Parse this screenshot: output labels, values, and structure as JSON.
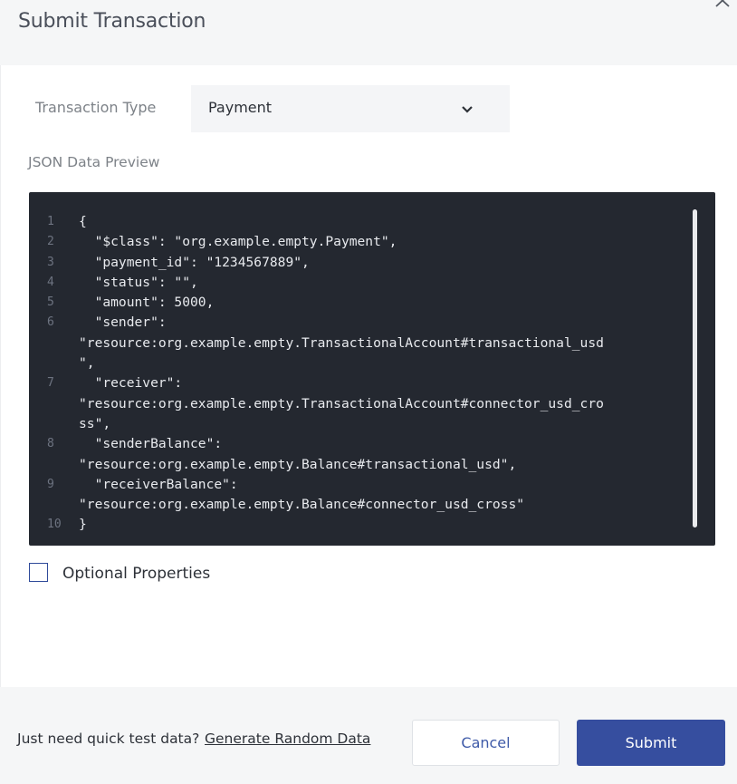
{
  "dialog": {
    "title": "Submit Transaction",
    "close_icon": "close-icon"
  },
  "form": {
    "type_label": "Transaction Type",
    "type_value": "Payment",
    "preview_label": "JSON Data Preview"
  },
  "editor": {
    "lines": [
      {
        "n": "1",
        "text": "{"
      },
      {
        "n": "2",
        "text": "  \"$class\": \"org.example.empty.Payment\","
      },
      {
        "n": "3",
        "text": "  \"payment_id\": \"1234567889\","
      },
      {
        "n": "4",
        "text": "  \"status\": \"\","
      },
      {
        "n": "5",
        "text": "  \"amount\": 5000,"
      },
      {
        "n": "6",
        "text": "  \"sender\":"
      },
      {
        "n": "",
        "text": "\"resource:org.example.empty.TransactionalAccount#transactional_usd"
      },
      {
        "n": "",
        "text": "\","
      },
      {
        "n": "7",
        "text": "  \"receiver\":"
      },
      {
        "n": "",
        "text": "\"resource:org.example.empty.TransactionalAccount#connector_usd_cro"
      },
      {
        "n": "",
        "text": "ss\","
      },
      {
        "n": "8",
        "text": "  \"senderBalance\":"
      },
      {
        "n": "",
        "text": "\"resource:org.example.empty.Balance#transactional_usd\","
      },
      {
        "n": "9",
        "text": "  \"receiverBalance\":"
      },
      {
        "n": "",
        "text": "\"resource:org.example.empty.Balance#connector_usd_cross\""
      },
      {
        "n": "10",
        "text": "}"
      }
    ]
  },
  "options": {
    "optional_label": "Optional Properties",
    "checked": false
  },
  "footer": {
    "quick_text": "Just need quick test data?",
    "generate_link": "Generate Random Data",
    "cancel_label": "Cancel",
    "submit_label": "Submit"
  },
  "colors": {
    "primary": "#364e9f",
    "editor_bg": "#242830",
    "header_bg": "#f5f6f7"
  }
}
